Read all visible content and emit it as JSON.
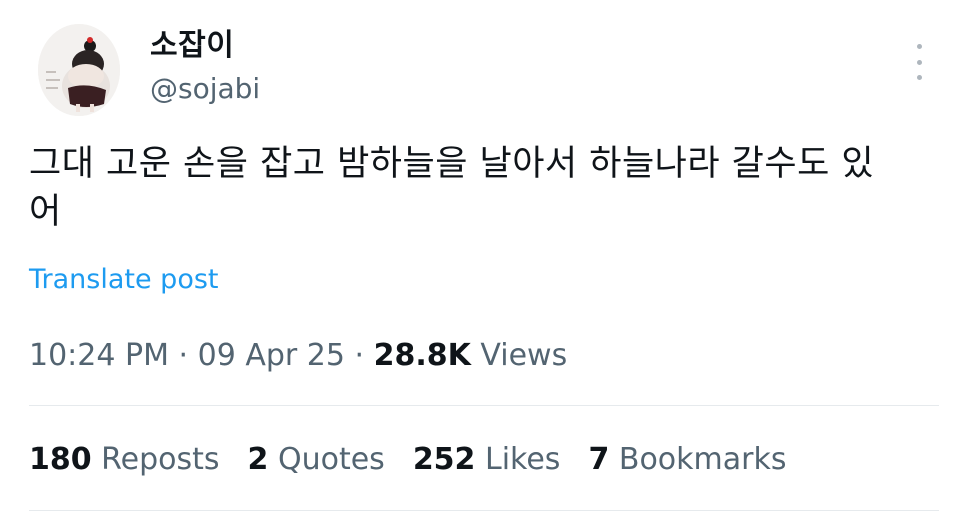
{
  "user": {
    "display_name": "소잡이",
    "handle": "@sojabi",
    "avatar_icon": "profile-photo"
  },
  "tweet": {
    "text": "그대 고운 손을 잡고 밤하늘을 날아서 하늘나라 갈수도 있\n어",
    "translate_label": "Translate post"
  },
  "meta": {
    "time": "10:24 PM",
    "date": "09 Apr 25",
    "views_count": "28.8K",
    "views_label": "Views",
    "separator": "·"
  },
  "stats": {
    "reposts_count": "180",
    "reposts_label": "Reposts",
    "quotes_count": "2",
    "quotes_label": "Quotes",
    "likes_count": "252",
    "likes_label": "Likes",
    "bookmarks_count": "7",
    "bookmarks_label": "Bookmarks"
  },
  "icons": {
    "more": "more-vertical-icon"
  },
  "colors": {
    "link": "#1d9bf0",
    "secondary_text": "#536471",
    "primary_text": "#0f1419",
    "divider": "#e6eaed"
  }
}
